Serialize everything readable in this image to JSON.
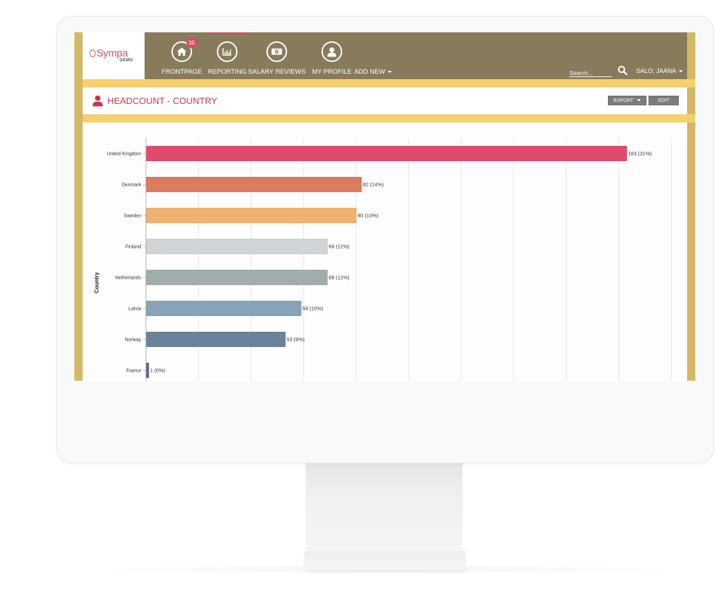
{
  "app": {
    "logo_text": "Sympa",
    "logo_subtext": "DEMO"
  },
  "nav": {
    "items": [
      {
        "label": "FRONTPAGE",
        "icon": "home-icon",
        "badge": "35"
      },
      {
        "label": "REPORTING",
        "icon": "bar-chart-icon"
      },
      {
        "label": "SALARY REVIEWS",
        "icon": "banknote-icon"
      },
      {
        "label": "MY PROFILE",
        "icon": "user-icon"
      }
    ],
    "add_new_label": "ADD NEW",
    "search_placeholder": "Search...",
    "user_name": "SALO, JAANA"
  },
  "page": {
    "title": "HEADCOUNT - COUNTRY",
    "export_label": "EXPORT",
    "edit_label": "EDIT"
  },
  "colors": {
    "accent": "#e4485f",
    "header_bg": "#887b5c",
    "band_yellow": "#f4d06e",
    "frame_gold": "#d4b865",
    "button_gray": "#7c7c7c"
  },
  "chart_data": {
    "type": "bar",
    "orientation": "horizontal",
    "title": "HEADCOUNT - COUNTRY",
    "xlabel": "",
    "ylabel": "Country",
    "xlim": [
      0,
      200
    ],
    "x_grid_step": 20,
    "grid": true,
    "categories": [
      "United Kingdom",
      "Denmark",
      "Sweden",
      "Finland",
      "Netherlands",
      "Latvia",
      "Norway",
      "France"
    ],
    "values": [
      183,
      82,
      80,
      69,
      69,
      59,
      53,
      1
    ],
    "percents": [
      "31%",
      "14%",
      "13%",
      "12%",
      "12%",
      "10%",
      "9%",
      "0%"
    ],
    "data_labels": [
      "183 (31%)",
      "82 (14%)",
      "80 (13%)",
      "69 (12%)",
      "69 (12%)",
      "59 (10%)",
      "53 (9%)",
      "1 (0%)"
    ],
    "bar_colors": [
      "#e04a6f",
      "#dc7b5e",
      "#f0b26e",
      "#d1d4d7",
      "#a3acad",
      "#87a3b5",
      "#6a839b",
      "#5a6982"
    ]
  }
}
